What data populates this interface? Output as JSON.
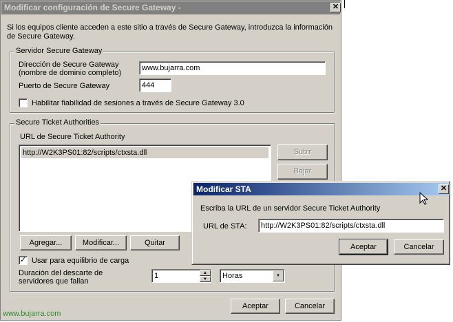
{
  "main_dialog": {
    "title": "Modificar configuración de Secure Gateway -",
    "close_glyph": "✕",
    "intro_line1": "Si los equipos cliente acceden a este sitio a través de Secure Gateway, introduzca la información",
    "intro_line2": "de Secure Gateway.",
    "gateway_group": {
      "legend": "Servidor Secure Gateway",
      "address_label1": "Dirección de Secure Gateway",
      "address_label2": "(nombre de dominio completo)",
      "address_value": "www.bujarra.com",
      "port_label": "Puerto de Secure Gateway",
      "port_value": "444",
      "reliability_label": "Habilitar fiabilidad de sesiones a través de Secure Gateway 3.0",
      "reliability_checked": false
    },
    "sta_group": {
      "legend": "Secure Ticket Authorities",
      "url_label": "URL de Secure Ticket Authority",
      "urls": [
        "http://W2K3PS01:82/scripts/ctxsta.dll"
      ],
      "up_label": "Subir",
      "down_label": "Bajar",
      "add_label": "Agregar...",
      "modify_label": "Modificar...",
      "remove_label": "Quitar",
      "load_balance_label": "Usar para equilibrio de carga",
      "load_balance_checked": true,
      "check_glyph": "✓",
      "bypass_label1": "Duración del descarte de",
      "bypass_label2": "servidores que fallan",
      "bypass_value": "1",
      "bypass_unit": "Horas"
    },
    "accept_label": "Aceptar",
    "cancel_label": "Cancelar"
  },
  "sta_dialog": {
    "title": "Modificar STA",
    "close_glyph": "✕",
    "prompt": "Escriba la URL de un servidor Secure Ticket Authority",
    "url_label": "URL de STA:",
    "url_value": "http://W2K3PS01:82/scripts/ctxsta.dll",
    "accept_label": "Aceptar",
    "cancel_label": "Cancelar"
  },
  "watermark": "www.bujarra.com",
  "colors": {
    "title_inactive": "#808080",
    "title_active": "#0a246a",
    "dialog_face": "#d4d0c8",
    "watermark": "#2e8b2e"
  }
}
